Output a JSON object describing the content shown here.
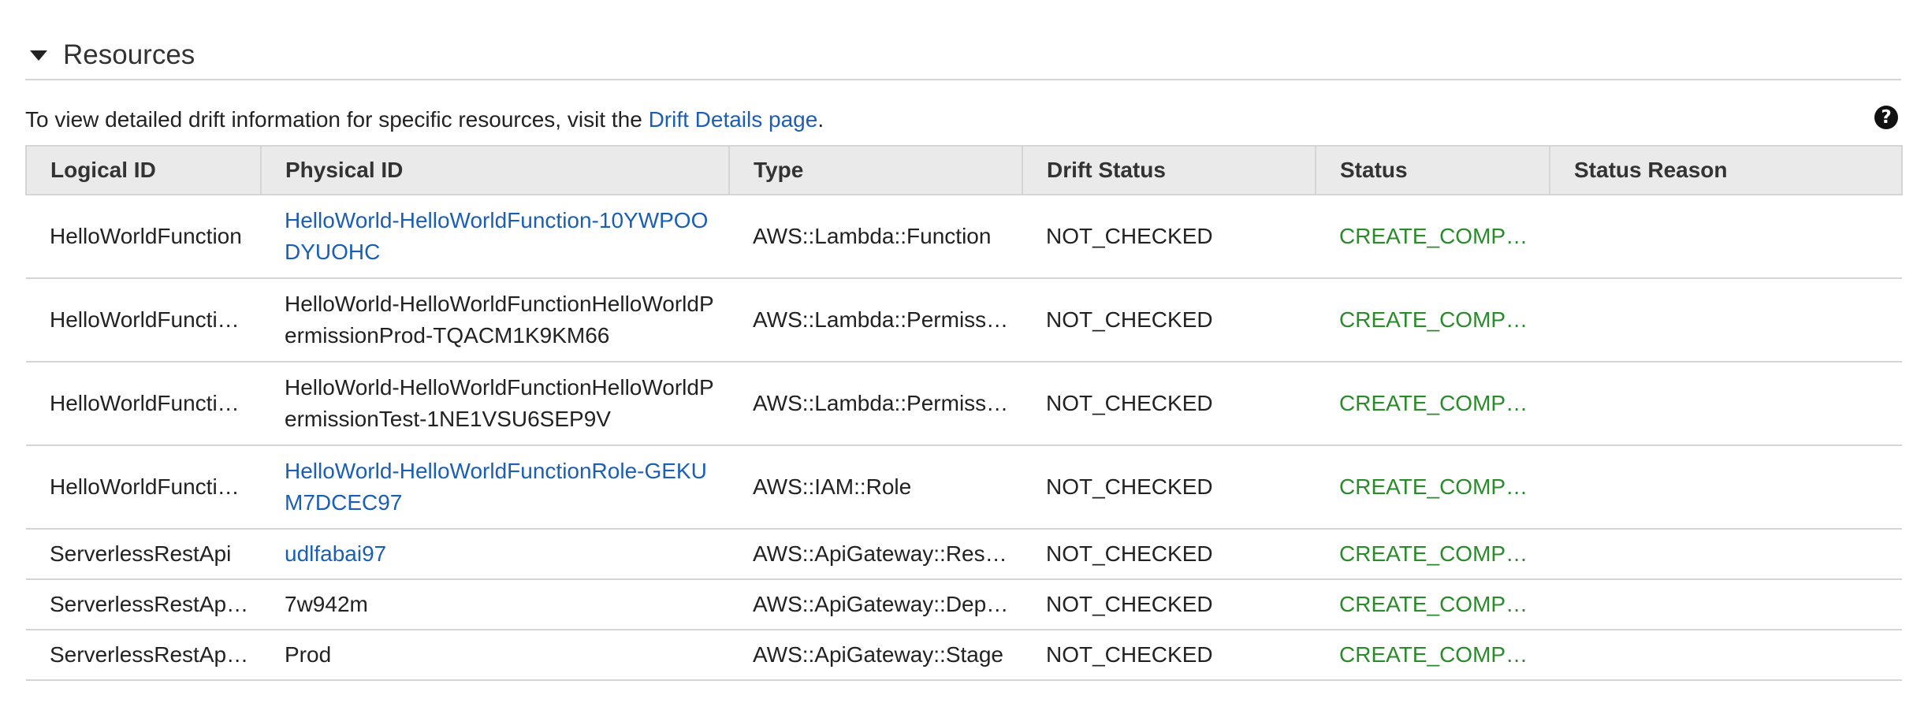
{
  "section": {
    "title": "Resources"
  },
  "info": {
    "prefix": "To view detailed drift information for specific resources, visit the ",
    "link_text": "Drift Details page",
    "suffix": "."
  },
  "help_icon": "?",
  "colors": {
    "link": "#1b5fb4",
    "status_ok": "#2b8a2b",
    "header_bg": "#eaeaea",
    "border": "#d5d5d5"
  },
  "table": {
    "columns": [
      "Logical ID",
      "Physical ID",
      "Type",
      "Drift Status",
      "Status",
      "Status Reason"
    ],
    "rows": [
      {
        "logical_id": "HelloWorldFunction",
        "physical_id": "HelloWorld-HelloWorldFunction-10YWPOODYUOHC",
        "type": "AWS::Lambda::Function",
        "drift_status": "NOT_CHECKED",
        "status": "CREATE_COMPLETE",
        "status_reason": ""
      },
      {
        "logical_id": "HelloWorldFunctionHelloWorldPermissionProd",
        "physical_id": "HelloWorld-HelloWorldFunctionHelloWorldPermissionProd-TQACM1K9KM66",
        "type": "AWS::Lambda::Permission",
        "drift_status": "NOT_CHECKED",
        "status": "CREATE_COMPLETE",
        "status_reason": ""
      },
      {
        "logical_id": "HelloWorldFunctionHelloWorldPermissionTest",
        "physical_id": "HelloWorld-HelloWorldFunctionHelloWorldPermissionTest-1NE1VSU6SEP9V",
        "type": "AWS::Lambda::Permission",
        "drift_status": "NOT_CHECKED",
        "status": "CREATE_COMPLETE",
        "status_reason": ""
      },
      {
        "logical_id": "HelloWorldFunctionRole",
        "physical_id": "HelloWorld-HelloWorldFunctionRole-GEKUM7DCEC97",
        "type": "AWS::IAM::Role",
        "drift_status": "NOT_CHECKED",
        "status": "CREATE_COMPLETE",
        "status_reason": ""
      },
      {
        "logical_id": "ServerlessRestApi",
        "physical_id": "udlfabai97",
        "type": "AWS::ApiGateway::RestApi",
        "drift_status": "NOT_CHECKED",
        "status": "CREATE_COMPLETE",
        "status_reason": ""
      },
      {
        "logical_id": "ServerlessRestApiDeployment",
        "physical_id": "7w942m",
        "type": "AWS::ApiGateway::Deployment",
        "drift_status": "NOT_CHECKED",
        "status": "CREATE_COMPLETE",
        "status_reason": ""
      },
      {
        "logical_id": "ServerlessRestApiProdStage",
        "physical_id": "Prod",
        "type": "AWS::ApiGateway::Stage",
        "drift_status": "NOT_CHECKED",
        "status": "CREATE_COMPLETE",
        "status_reason": ""
      }
    ]
  }
}
